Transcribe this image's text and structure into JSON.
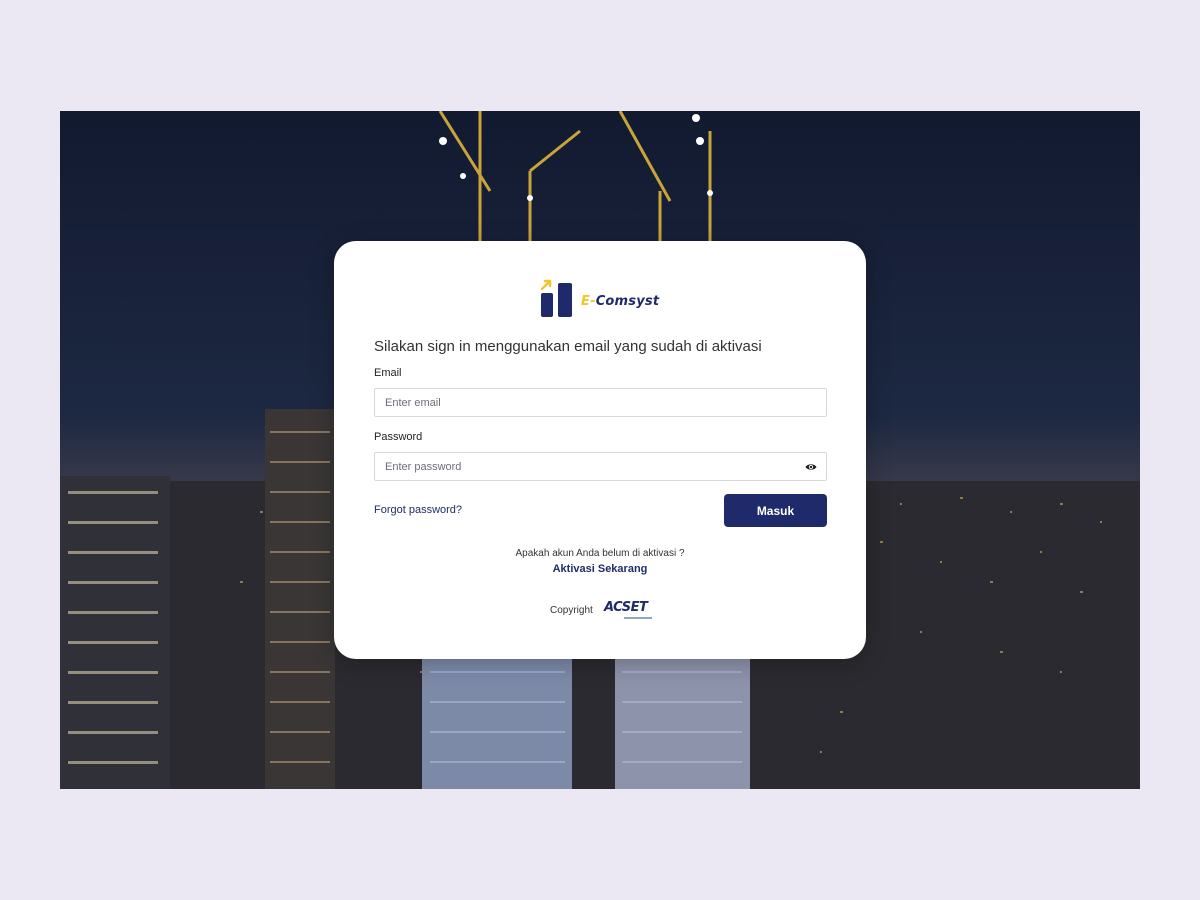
{
  "brand": {
    "name_prefix": "E-",
    "name_rest": "Comsyst",
    "primary_color": "#1f2a6b",
    "accent_color": "#f4c42a"
  },
  "login": {
    "prompt": "Silakan sign in menggunakan email yang sudah di aktivasi",
    "email_label": "Email",
    "email_placeholder": "Enter email",
    "password_label": "Password",
    "password_placeholder": "Enter password",
    "forgot_password": "Forgot password?",
    "submit_label": "Masuk"
  },
  "activation": {
    "question": "Apakah akun Anda belum di aktivasi ?",
    "link": "Aktivasi Sekarang"
  },
  "footer": {
    "copyright": "Copyright",
    "company_logo_text": "ACSET"
  },
  "icons": {
    "password_toggle": "eye-icon",
    "brand_logo": "bar-chart-arrow-icon"
  }
}
